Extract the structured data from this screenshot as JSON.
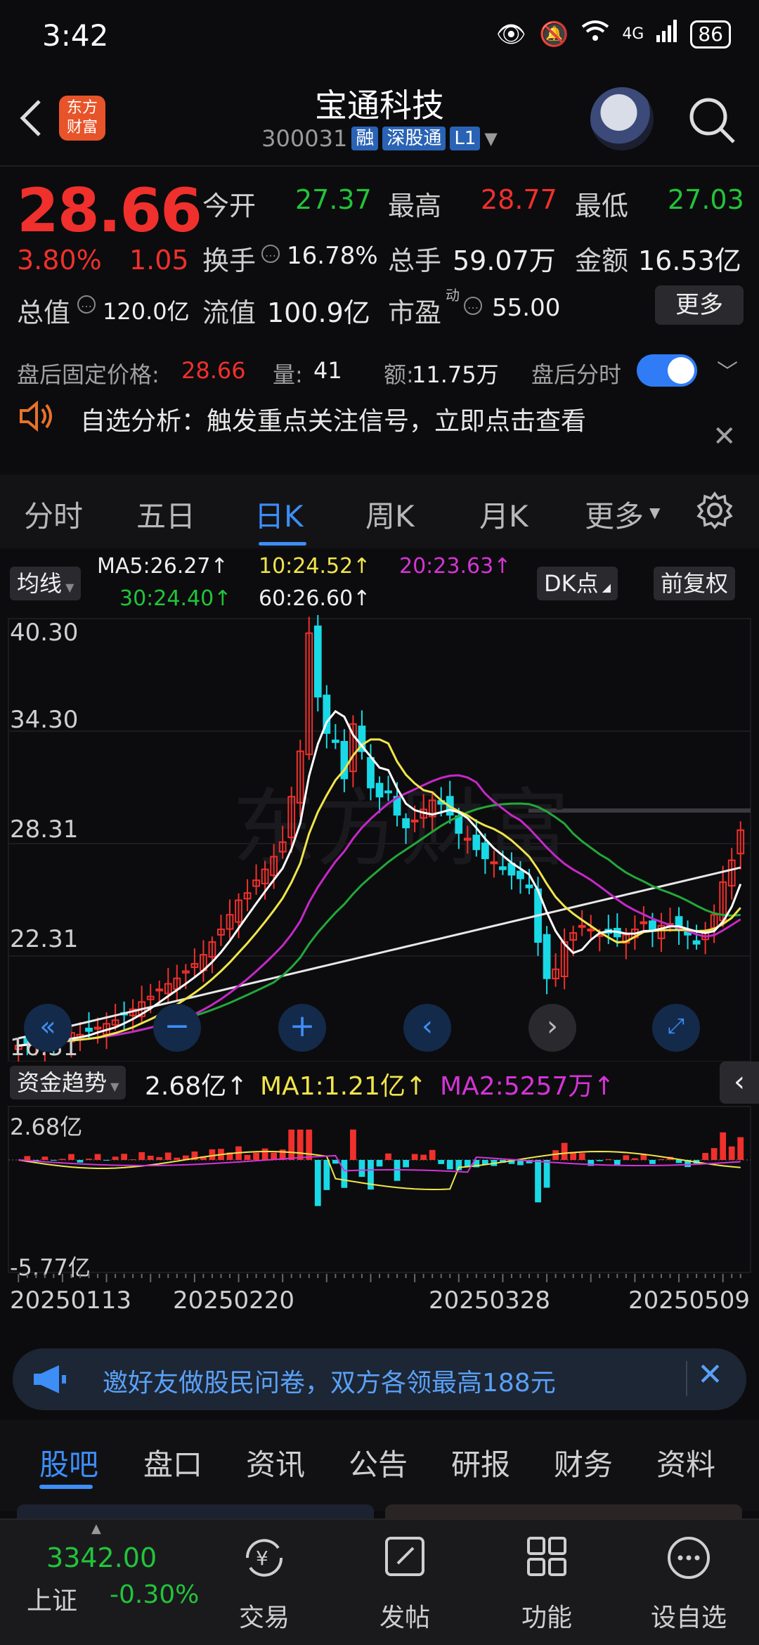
{
  "status": {
    "time": "3:42",
    "network": "4G",
    "battery": "86"
  },
  "header": {
    "logo_line1": "东方",
    "logo_line2": "财富",
    "title": "宝通科技",
    "code": "300031",
    "tags": [
      "融",
      "深股通",
      "L1"
    ]
  },
  "quote": {
    "price": "28.66",
    "pct": "3.80%",
    "change": "1.05",
    "open_label": "今开",
    "open": "27.37",
    "high_label": "最高",
    "high": "28.77",
    "low_label": "最低",
    "low": "27.03",
    "turnover_label": "换手",
    "turnover": "16.78%",
    "volume_label": "总手",
    "volume": "59.07万",
    "amount_label": "金额",
    "amount": "16.53亿",
    "mktcap_label": "总值",
    "mktcap": "120.0亿",
    "float_label": "流值",
    "float": "100.9亿",
    "pe_label": "市盈",
    "pe_sup": "动",
    "pe": "55.00",
    "more": "更多"
  },
  "after_hours": {
    "price_label": "盘后固定价格:",
    "price": "28.66",
    "vol_label": "量:",
    "vol": "41",
    "amt_label": "额:",
    "amt": "11.75万",
    "timeshare_label": "盘后分时"
  },
  "notice": {
    "text": "自选分析：触发重点关注信号，立即点击查看"
  },
  "tabs": [
    "分时",
    "五日",
    "日K",
    "周K",
    "月K",
    "更多"
  ],
  "ma_row": {
    "type": "均线",
    "ma5": "MA5:26.27↑",
    "ma10": "10:24.52↑",
    "ma20": "20:23.63↑",
    "ma30": "30:24.40↑",
    "ma60": "60:26.60↑",
    "dk": "DK点",
    "fq": "前复权"
  },
  "price_axis": [
    "40.30",
    "34.30",
    "28.31",
    "22.31",
    "16.31"
  ],
  "flow_row": {
    "type": "资金趋势",
    "value": "2.68亿↑",
    "ma1": "MA1:1.21亿↑",
    "ma2": "MA2:5257万↑"
  },
  "flow_axis": [
    "2.68亿",
    "-5.77亿"
  ],
  "dates": [
    "20250113",
    "20250220",
    "20250328",
    "20250509"
  ],
  "banner": {
    "text": "邀好友做股民问卷，双方各领最高188元"
  },
  "bottom_tabs": [
    "股吧",
    "盘口",
    "资讯",
    "公告",
    "研报",
    "财务",
    "资料"
  ],
  "bottom_nav": {
    "index_value": "3342.00",
    "index_name": "上证",
    "index_pct": "-0.30%",
    "trade": "交易",
    "post": "发帖",
    "func": "功能",
    "watch": "设自选"
  },
  "colors": {
    "up": "#f0302c",
    "down": "#22c43a",
    "accent": "#3d8ef7",
    "candle_down": "#19d9e6"
  },
  "chart_data": {
    "type": "candlestick",
    "ylim": [
      16.31,
      40.3
    ],
    "x_ticks": [
      "20250113",
      "20250220",
      "20250328",
      "20250509"
    ],
    "series_names": [
      "MA5",
      "MA10",
      "MA20",
      "MA30",
      "MA60"
    ],
    "flow_ylim": [
      -5.77,
      2.68
    ]
  }
}
